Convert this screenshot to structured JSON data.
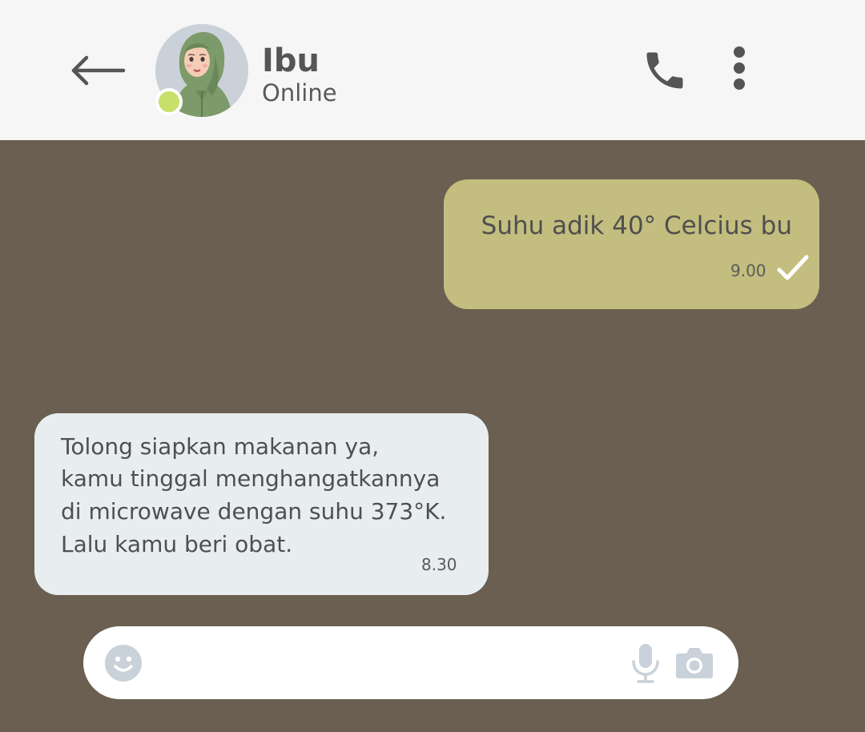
{
  "header": {
    "contact_name": "Ibu",
    "status": "Online",
    "icons": {
      "back": "arrow-left-icon",
      "call": "phone-icon",
      "menu": "more-vertical-icon"
    }
  },
  "messages": [
    {
      "direction": "outgoing",
      "lines": [
        "Suhu adik 40° Celcius bu"
      ],
      "time": "9.00",
      "status_icon": "check-icon"
    },
    {
      "direction": "incoming",
      "lines": [
        "Tolong siapkan makanan ya,",
        "kamu tinggal menghangatkannya",
        "di microwave dengan suhu 373°K.",
        "Lalu kamu beri obat."
      ],
      "time": "8.30"
    }
  ],
  "composer": {
    "value": "",
    "placeholder": "",
    "icons": [
      "emoji-icon",
      "microphone-icon",
      "camera-icon"
    ]
  },
  "colors": {
    "header_bg": "#f6f6f6",
    "chat_bg": "#6a5f51",
    "outgoing_bubble": "#c3bd7f",
    "incoming_bubble": "#e8eef0",
    "online_indicator": "#c6e06a",
    "composer_icon": "#c9d1da"
  }
}
